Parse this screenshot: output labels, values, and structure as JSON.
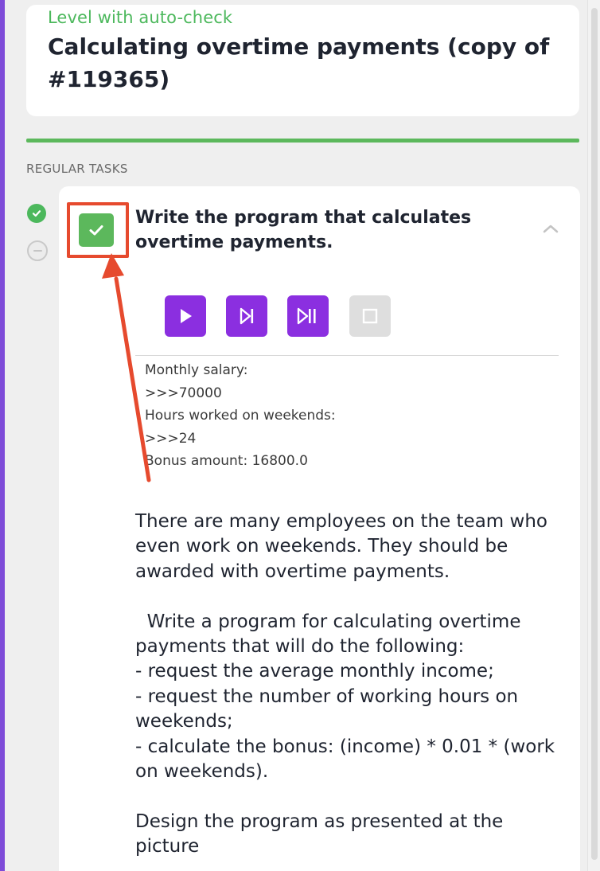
{
  "header": {
    "level_label": "Level with auto-check",
    "title": "Calculating overtime payments (copy of #119365)"
  },
  "section_label": "REGULAR TASKS",
  "steps": [
    {
      "status": "done",
      "icon": "check-circle-icon"
    },
    {
      "status": "pending",
      "icon": "minus-circle-icon"
    }
  ],
  "task": {
    "title": "Write the program that calculates overtime payments.",
    "completed": true,
    "expanded": true,
    "player_buttons": [
      {
        "name": "play-button",
        "icon": "play-icon",
        "enabled": true
      },
      {
        "name": "step-button",
        "icon": "step-forward-icon",
        "enabled": true
      },
      {
        "name": "step-pause-button",
        "icon": "step-pause-icon",
        "enabled": true
      },
      {
        "name": "stop-button",
        "icon": "stop-icon",
        "enabled": false
      }
    ],
    "console_lines": [
      "Monthly salary:",
      ">>>70000",
      "Hours worked on weekends:",
      ">>>24",
      "Bonus amount: 16800.0"
    ],
    "description": {
      "intro": "There are many employees on the team who even work on weekends. They should be awarded with overtime payments.",
      "instruction": "  Write a program for calculating overtime payments that will do the following:",
      "bullets": [
        "- request the average monthly income;",
        "- request the number of working hours on weekends;",
        "- calculate the bonus: (income) * 0.01 * (work on weekends)."
      ],
      "footer": "Design the program as presented at the picture"
    }
  },
  "colors": {
    "accent_green": "#5cb85c",
    "label_green": "#4cb85c",
    "player_purple": "#8b2fe0",
    "sidebar_purple": "#7e4bd8",
    "annotation_red": "#e64a2e"
  }
}
